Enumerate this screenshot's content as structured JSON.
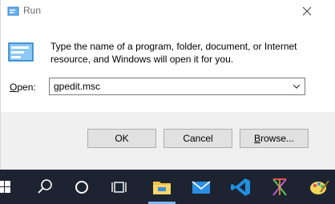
{
  "window": {
    "title": "Run",
    "message": "Type the name of a program, folder, document, or Internet resource, and Windows will open it for you.",
    "open_label_mnemonic": "O",
    "open_label_rest": "pen:",
    "open_value": "gpedit.msc"
  },
  "buttons": {
    "ok": "OK",
    "cancel": "Cancel",
    "browse_mnemonic": "B",
    "browse_rest": "rowse..."
  },
  "taskbar": {
    "items": [
      "windows-start-icon",
      "search-icon",
      "cortana-icon",
      "task-view-icon",
      "file-explorer-icon",
      "mail-icon",
      "vscode-icon",
      "app-icon",
      "paint-icon"
    ]
  },
  "colors": {
    "taskbar_bg": "#1d2330",
    "dialog_footer": "#f0f0f0",
    "accent": "#1f8fe0"
  }
}
